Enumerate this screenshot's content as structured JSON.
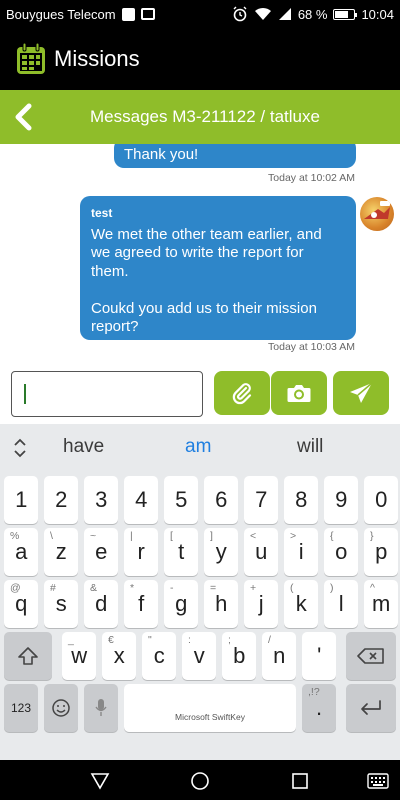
{
  "status_bar": {
    "carrier": "Bouygues Telecom",
    "battery": "68 %",
    "battery_level": 0.68,
    "time": "10:04"
  },
  "app": {
    "title": "Missions",
    "accent": "#8fbd2a",
    "bubble_color": "#2e86c9"
  },
  "header": {
    "title": "Messages M3-211122 / tatluxe"
  },
  "messages": [
    {
      "text": "Thank you!",
      "timestamp": "Today at 10:02 AM"
    },
    {
      "sender": "test",
      "lines": [
        "We met the other team earlier, and",
        "we agreed to write the report for",
        "them.",
        "",
        "Coukd you add us to their mission",
        "report?"
      ],
      "timestamp": "Today at 10:03 AM"
    }
  ],
  "composer": {
    "value": ""
  },
  "keyboard": {
    "suggestions": [
      "have",
      "am",
      "will"
    ],
    "row_numbers": [
      "1",
      "2",
      "3",
      "4",
      "5",
      "6",
      "7",
      "8",
      "9",
      "0"
    ],
    "row1": [
      [
        "a",
        "%"
      ],
      [
        "z",
        "\\"
      ],
      [
        "e",
        "~"
      ],
      [
        "r",
        "|"
      ],
      [
        "t",
        "["
      ],
      [
        "y",
        "]"
      ],
      [
        "u",
        "<"
      ],
      [
        "i",
        ">"
      ],
      [
        "o",
        "{"
      ],
      [
        "p",
        "}"
      ]
    ],
    "row2": [
      [
        "q",
        "@"
      ],
      [
        "s",
        "#"
      ],
      [
        "d",
        "&"
      ],
      [
        "f",
        "*"
      ],
      [
        "g",
        "-"
      ],
      [
        "h",
        "="
      ],
      [
        "j",
        "+"
      ],
      [
        "k",
        "("
      ],
      [
        "l",
        ")"
      ],
      [
        "m",
        "^"
      ]
    ],
    "row3": [
      [
        "w",
        "_"
      ],
      [
        "x",
        "€"
      ],
      [
        "c",
        "\""
      ],
      [
        "v",
        ":"
      ],
      [
        "b",
        ";"
      ],
      [
        "n",
        "/"
      ],
      [
        "'",
        ""
      ]
    ],
    "row4": {
      "num_key": "123",
      "space_label": "Microsoft SwiftKey",
      "punct_sub": ",!?",
      "period": "."
    }
  }
}
